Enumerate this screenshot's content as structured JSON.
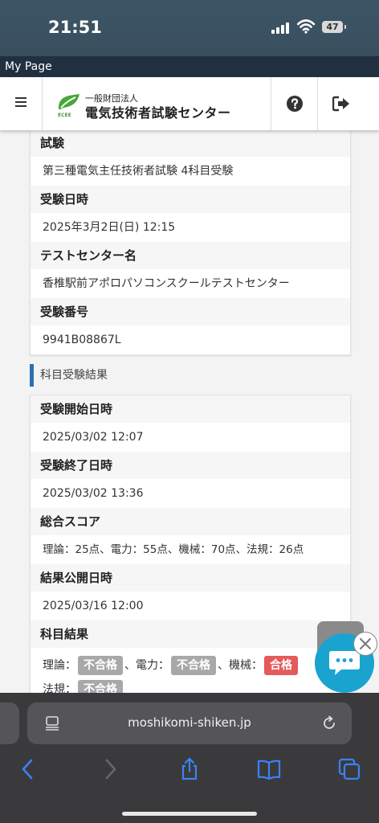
{
  "status": {
    "time": "21:51",
    "battery": "47"
  },
  "window": {
    "title": "My Page"
  },
  "header": {
    "logo_small": "一般財団法人",
    "logo_main": "電気技術者試験センター",
    "logo_sub": "ECEE"
  },
  "exam_info": [
    {
      "label": "試験",
      "value": "第三種電気主任技術者試験 4科目受験"
    },
    {
      "label": "受験日時",
      "value": "2025年3月2日(日) 12:15"
    },
    {
      "label": "テストセンター名",
      "value": "香椎駅前アポロパソコンスクールテストセンター"
    },
    {
      "label": "受験番号",
      "value": "9941B08867L"
    }
  ],
  "section": {
    "title": "科目受験結果"
  },
  "result_info": [
    {
      "label": "受験開始日時",
      "value": "2025/03/02 12:07"
    },
    {
      "label": "受験終了日時",
      "value": "2025/03/02 13:36"
    },
    {
      "label": "総合スコア",
      "value": "理論：25点、電力：55点、機械：70点、法規：26点"
    },
    {
      "label": "結果公開日時",
      "value": "2025/03/16 12:00"
    }
  ],
  "subject_results": {
    "label": "科目結果",
    "items": [
      {
        "subject": "理論：",
        "result": "不合格",
        "sep": "、"
      },
      {
        "subject": "電力：",
        "result": "不合格",
        "sep": "、"
      },
      {
        "subject": "機械：",
        "result": "合格",
        "sep": ""
      },
      {
        "subject": "法規：",
        "result": "不合格",
        "sep": ""
      }
    ]
  },
  "browser": {
    "url": "moshikomi-shiken.jp"
  },
  "colors": {
    "accent": "#2c6fb0",
    "fail": "#a8a8a8",
    "pass": "#e55a5a",
    "chat": "#1aa3cf"
  }
}
